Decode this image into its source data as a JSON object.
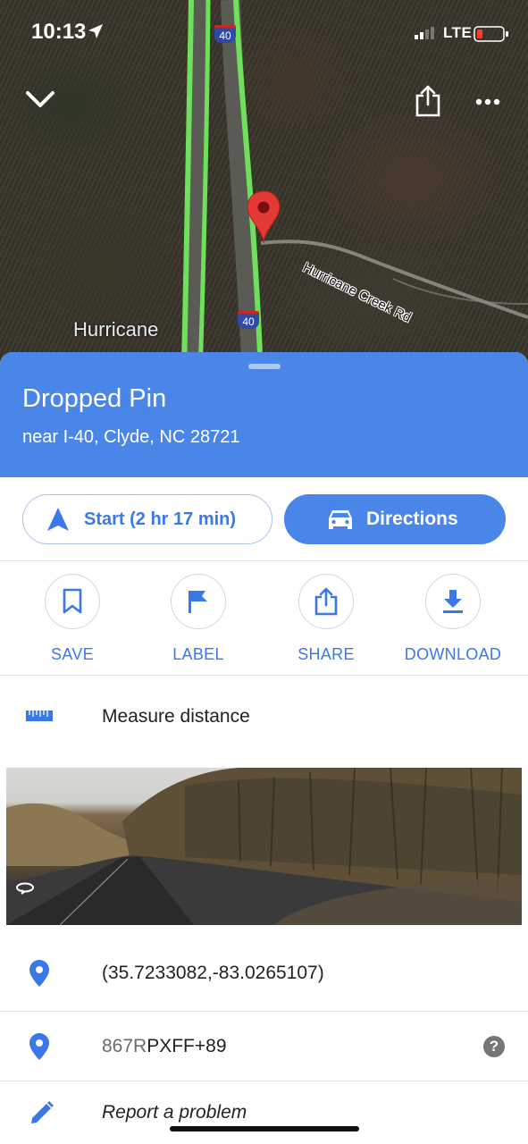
{
  "status_bar": {
    "time": "10:13",
    "network": "LTE"
  },
  "map": {
    "place_label": "Hurricane",
    "road_label": "Hurricane Creek Rd",
    "interstate_number": "40",
    "icons": {
      "collapse": "chevron-down-icon",
      "share": "share-icon",
      "more": "more-horiz-icon",
      "pin": "map-pin-icon"
    }
  },
  "place": {
    "title": "Dropped Pin",
    "subtitle": "near I-40, Clyde, NC 28721"
  },
  "actions": {
    "start_label": "Start (2 hr 17 min)",
    "directions_label": "Directions"
  },
  "quick_actions": [
    {
      "label": "SAVE",
      "icon": "bookmark-icon"
    },
    {
      "label": "LABEL",
      "icon": "flag-icon"
    },
    {
      "label": "SHARE",
      "icon": "share-icon"
    },
    {
      "label": "DOWNLOAD",
      "icon": "download-icon"
    }
  ],
  "measure": {
    "label": "Measure distance",
    "icon": "ruler-icon"
  },
  "details": {
    "coordinates": "(35.7233082,-83.0265107)",
    "plus_code_prefix": "867R",
    "plus_code_rest": "PXFF+89",
    "help_symbol": "?",
    "report": "Report a problem"
  },
  "colors": {
    "accent": "#4a86e8",
    "accent_text": "#3b78e7",
    "route": "#6ee05a",
    "pin": "#e53935"
  }
}
